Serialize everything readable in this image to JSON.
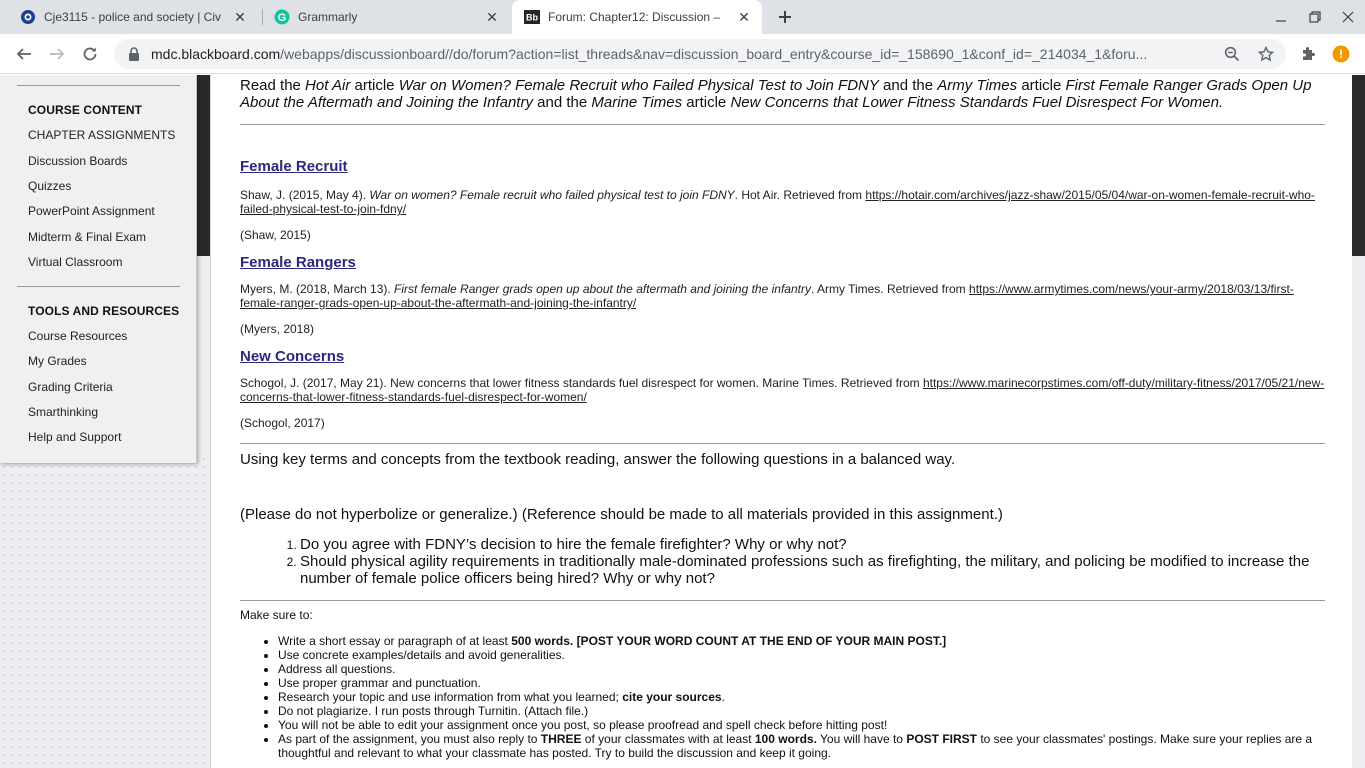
{
  "browser": {
    "tabs": [
      {
        "title": "Cje3115 - police and society | Civ",
        "icon": "course-icon"
      },
      {
        "title": "Grammarly",
        "icon": "grammarly-icon"
      },
      {
        "title": "Forum: Chapter12: Discussion –",
        "icon": "blackboard-icon",
        "favicon_text": "Bb"
      }
    ],
    "url_host": "mdc.blackboard.com",
    "url_path": "/webapps/discussionboard//do/forum?action=list_threads&nav=discussion_board_entry&course_id=_158690_1&conf_id=_214034_1&foru...",
    "profile_initial": "!"
  },
  "sidebar": {
    "course_content_heading": "COURSE CONTENT",
    "course_items": [
      "CHAPTER ASSIGNMENTS",
      "Discussion Boards",
      "Quizzes",
      "PowerPoint Assignment",
      "Midterm & Final Exam",
      "Virtual Classroom"
    ],
    "tools_heading": "TOOLS AND RESOURCES",
    "tools_items": [
      "Course Resources",
      "My Grades",
      "Grading Criteria",
      "Smarthinking",
      "Help and Support"
    ]
  },
  "intro": {
    "t1": "Read the ",
    "i1": "Hot Air",
    "t2": " article ",
    "i2": "War on Women? Female Recruit who Failed Physical Test to Join FDNY",
    "t3": " and the ",
    "i3": "Army Times",
    "t4": " article ",
    "i4": "First Female Ranger Grads Open Up About the Aftermath and Joining the Infantry",
    "t5": " and the ",
    "i5": "Marine Times",
    "t6": " article ",
    "i6": "New Concerns that Lower Fitness Standards Fuel Disrespect For Women."
  },
  "references": [
    {
      "heading": "Female Recruit",
      "pre": "Shaw, J. (2015, May 4). ",
      "italic": "War on women? Female recruit who failed physical test to join FDNY",
      "post": ". Hot Air. Retrieved from ",
      "link": "https://hotair.com/archives/jazz-shaw/2015/05/04/war-on-women-female-recruit-who-failed-physical-test-to-join-fdny/",
      "citation": "(Shaw, 2015)"
    },
    {
      "heading": "Female Rangers",
      "pre": "Myers, M. (2018, March 13). ",
      "italic": "First female Ranger grads open up about the aftermath and joining the infantry",
      "post": ". Army Times. Retrieved from ",
      "link": "https://www.armytimes.com/news/your-army/2018/03/13/first-female-ranger-grads-open-up-about-the-aftermath-and-joining-the-infantry/",
      "citation": "(Myers, 2018)"
    },
    {
      "heading": "New Concerns",
      "pre": "Schogol, J. (2017, May 21). New concerns that lower fitness standards fuel disrespect for women. Marine Times. Retrieved from ",
      "italic": "",
      "post": "",
      "link": "https://www.marinecorpstimes.com/off-duty/military-fitness/2017/05/21/new-concerns-that-lower-fitness-standards-fuel-disrespect-for-women/",
      "citation": "(Schogol, 2017)"
    }
  ],
  "instructions": {
    "lead": "Using key terms and concepts from the textbook reading, answer the following questions in a balanced way.",
    "note": "(Please do not hyperbolize or generalize.) (Reference should be made to all materials provided in this assignment.)",
    "questions": [
      "Do you agree with FDNY’s decision to hire the female firefighter? Why or why not?",
      "Should physical agility requirements in traditionally male-dominated professions such as firefighting, the military, and policing be modified to increase the number of female police officers being hired?  Why or why not?"
    ]
  },
  "make_sure": {
    "heading": "Make sure to:",
    "r1a": "Write a short essay or paragraph of at least ",
    "r1b": "500 words. [POST YOUR WORD COUNT AT THE END OF YOUR MAIN POST.]",
    "r2": "Use concrete examples/details and avoid generalities.",
    "r3": "Address all questions.",
    "r4": "Use proper grammar and punctuation.",
    "r5a": "Research your topic and use information from what you learned; ",
    "r5b": "cite your sources",
    "r5c": ".",
    "r6": "Do not plagiarize. I run posts through Turnitin. (Attach file.)",
    "r7": "You will not be able to edit your assignment once you post, so please proofread and spell check before hitting post!",
    "r8a": "As part of the assignment, you must also reply to ",
    "r8b": "THREE",
    "r8c": " of your classmates with at least ",
    "r8d": "100 words.",
    "r8e": " You will have to ",
    "r8f": "POST FIRST",
    "r8g": " to see your classmates' postings. Make sure your replies are a thoughtful and relevant to what your classmate has posted. Try to build the discussion and keep it going."
  }
}
